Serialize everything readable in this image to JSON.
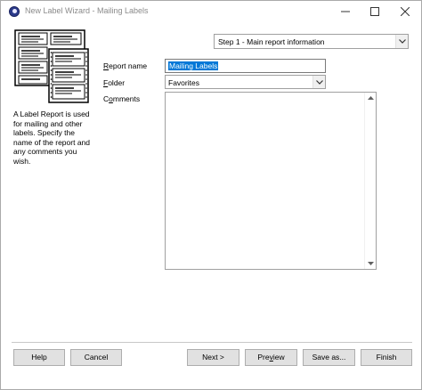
{
  "window": {
    "title": "New Label Wizard - Mailing Labels"
  },
  "left_panel": {
    "illustration_icon": "label-sheets-icon",
    "description": "A Label Report is used for mailing and other labels. Specify the name of the report and any comments you wish."
  },
  "step_selector": {
    "selected": "Step 1 - Main report information"
  },
  "form": {
    "report_name_label": "Report name",
    "report_name_value": "Mailing Labels",
    "folder_label": "Folder",
    "folder_value": "Favorites",
    "comments_label": "Comments",
    "comments_value": ""
  },
  "buttons": {
    "help": "Help",
    "cancel": "Cancel",
    "next": "Next >",
    "preview": "Preview",
    "save_as": "Save as...",
    "finish": "Finish"
  },
  "colors": {
    "selection": "#0078d7",
    "button_face": "#e1e1e1",
    "app_icon": "#2b3a8a"
  }
}
